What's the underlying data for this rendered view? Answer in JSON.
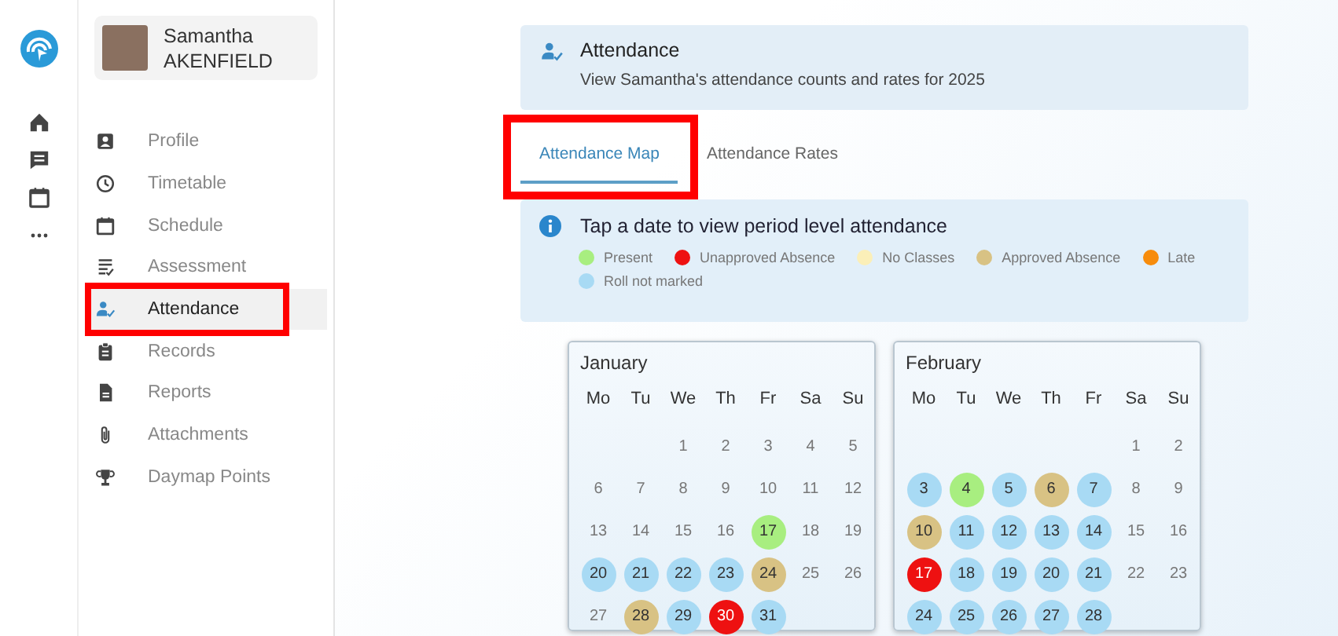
{
  "rail": {
    "items": [
      {
        "kind": "home"
      },
      {
        "kind": "messages"
      },
      {
        "kind": "calendar"
      },
      {
        "kind": "more"
      }
    ]
  },
  "profile": {
    "first_name": "Samantha",
    "last_name": "AKENFIELD"
  },
  "nav": [
    {
      "label": "Profile",
      "kind": "profile",
      "selected": false,
      "highlighted": false
    },
    {
      "label": "Timetable",
      "kind": "clock",
      "selected": false,
      "highlighted": false
    },
    {
      "label": "Schedule",
      "kind": "calendar",
      "selected": false,
      "highlighted": false
    },
    {
      "label": "Assessment",
      "kind": "list",
      "selected": false,
      "highlighted": false
    },
    {
      "label": "Attendance",
      "kind": "attendance",
      "selected": true,
      "highlighted": true
    },
    {
      "label": "Records",
      "kind": "clipboard",
      "selected": false,
      "highlighted": false
    },
    {
      "label": "Reports",
      "kind": "document",
      "selected": false,
      "highlighted": false
    },
    {
      "label": "Attachments",
      "kind": "paperclip",
      "selected": false,
      "highlighted": false
    },
    {
      "label": "Daymap Points",
      "kind": "trophy",
      "selected": false,
      "highlighted": false
    }
  ],
  "header": {
    "title": "Attendance",
    "subtitle": "View Samantha's attendance counts and rates for 2025"
  },
  "tabs": [
    {
      "label": "Attendance Map",
      "selected": true,
      "highlighted": true
    },
    {
      "label": "Attendance Rates",
      "selected": false,
      "highlighted": false
    }
  ],
  "info": {
    "message": "Tap a date to view period level attendance"
  },
  "legend": [
    {
      "label": "Present",
      "color": "#a8ee80"
    },
    {
      "label": "Unapproved Absence",
      "color": "#ee1111"
    },
    {
      "label": "No Classes",
      "color": "#fbefb8"
    },
    {
      "label": "Approved Absence",
      "color": "#d8c284"
    },
    {
      "label": "Late",
      "color": "#f78c0c"
    },
    {
      "label": "Roll not marked",
      "color": "#a8daf4"
    }
  ],
  "months": [
    {
      "name": "January",
      "weekdays": [
        "Mo",
        "Tu",
        "We",
        "Th",
        "Fr",
        "Sa",
        "Su"
      ],
      "weeks": [
        [
          {
            "day": "1"
          },
          {
            "day": "2"
          },
          {
            "day": "3"
          },
          {
            "day": "4"
          },
          {
            "day": "5"
          }
        ],
        [
          {
            "day": "6"
          },
          {
            "day": "7"
          },
          {
            "day": "8"
          },
          {
            "day": "9"
          },
          {
            "day": "10"
          },
          {
            "day": "11"
          },
          {
            "day": "12"
          }
        ],
        [
          {
            "day": "13"
          },
          {
            "day": "14"
          },
          {
            "day": "15"
          },
          {
            "day": "16"
          },
          {
            "day": "17",
            "color": "#a8ee80"
          },
          {
            "day": "18"
          },
          {
            "day": "19"
          }
        ],
        [
          {
            "day": "20",
            "color": "#a8daf4"
          },
          {
            "day": "21",
            "color": "#a8daf4"
          },
          {
            "day": "22",
            "color": "#a8daf4"
          },
          {
            "day": "23",
            "color": "#a8daf4"
          },
          {
            "day": "24",
            "color": "#d8c284"
          },
          {
            "day": "25"
          },
          {
            "day": "26"
          }
        ],
        [
          {
            "day": "27"
          },
          {
            "day": "28",
            "color": "#d8c284"
          },
          {
            "day": "29",
            "color": "#a8daf4"
          },
          {
            "day": "30",
            "color": "#ee1111"
          },
          {
            "day": "31",
            "color": "#a8daf4"
          }
        ]
      ]
    },
    {
      "name": "February",
      "weekdays": [
        "Mo",
        "Tu",
        "We",
        "Th",
        "Fr",
        "Sa",
        "Su"
      ],
      "weeks": [
        [
          {
            "day": "1"
          },
          {
            "day": "2"
          }
        ],
        [
          {
            "day": "3",
            "color": "#a8daf4"
          },
          {
            "day": "4",
            "color": "#a8ee80"
          },
          {
            "day": "5",
            "color": "#a8daf4"
          },
          {
            "day": "6",
            "color": "#d8c284"
          },
          {
            "day": "7",
            "color": "#a8daf4"
          },
          {
            "day": "8"
          },
          {
            "day": "9"
          }
        ],
        [
          {
            "day": "10",
            "color": "#d8c284"
          },
          {
            "day": "11",
            "color": "#a8daf4"
          },
          {
            "day": "12",
            "color": "#a8daf4"
          },
          {
            "day": "13",
            "color": "#a8daf4"
          },
          {
            "day": "14",
            "color": "#a8daf4"
          },
          {
            "day": "15"
          },
          {
            "day": "16"
          }
        ],
        [
          {
            "day": "17",
            "color": "#ee1111"
          },
          {
            "day": "18",
            "color": "#a8daf4"
          },
          {
            "day": "19",
            "color": "#a8daf4"
          },
          {
            "day": "20",
            "color": "#a8daf4"
          },
          {
            "day": "21",
            "color": "#a8daf4"
          },
          {
            "day": "22"
          },
          {
            "day": "23"
          }
        ],
        [
          {
            "day": "24",
            "color": "#a8daf4"
          },
          {
            "day": "25",
            "color": "#a8daf4"
          },
          {
            "day": "26",
            "color": "#a8daf4"
          },
          {
            "day": "27",
            "color": "#a8daf4"
          },
          {
            "day": "28",
            "color": "#a8daf4"
          }
        ]
      ]
    }
  ]
}
